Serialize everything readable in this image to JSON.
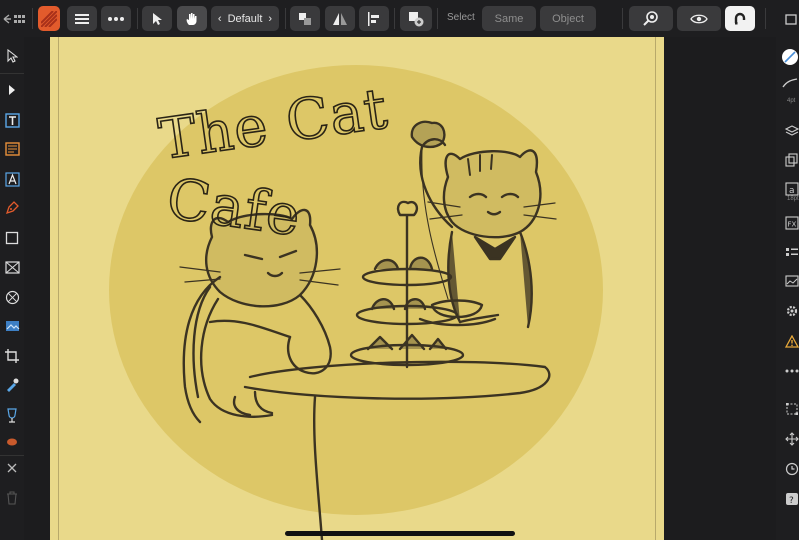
{
  "toolbar": {
    "style_label": "Default",
    "select_label": "Select",
    "same_label": "Same",
    "object_label": "Object"
  },
  "right_panel": {
    "stroke_size": "4pt",
    "font_size": "18pt"
  },
  "canvas": {
    "title_line1": "The Cat",
    "title_line2": "Cafe"
  },
  "colors": {
    "paper": "#e9d98a",
    "sun": "#ddc767",
    "ink": "#3b3322",
    "accent": "#e25b2c"
  }
}
